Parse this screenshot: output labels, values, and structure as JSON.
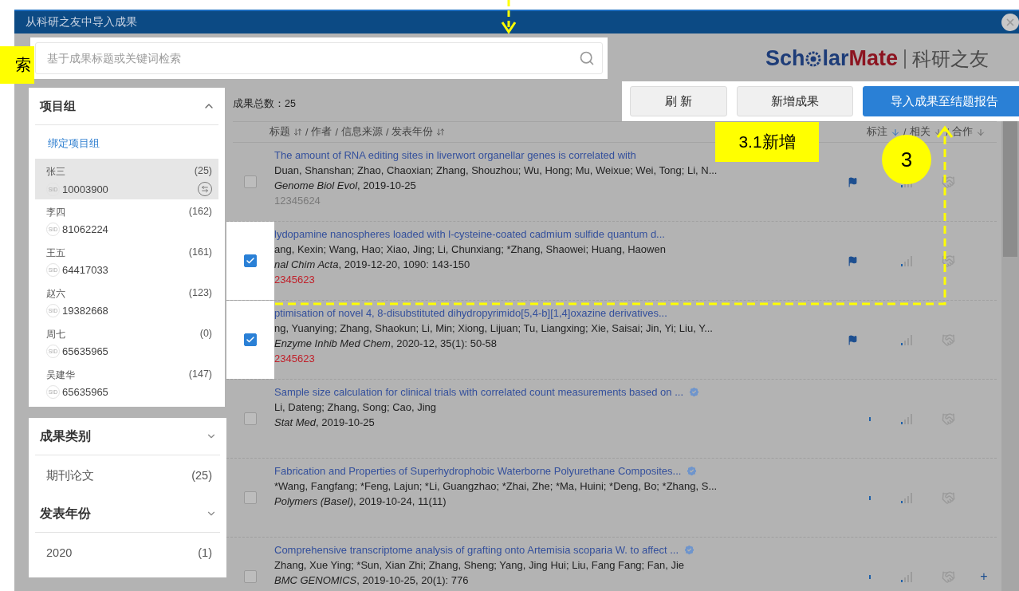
{
  "dialog": {
    "title": "从科研之友中导入成果"
  },
  "search": {
    "placeholder": "基于成果标题或关键词检索"
  },
  "logo": {
    "part_1": "Sch",
    "part_2": "lar",
    "part_3": "Mate",
    "tagline": "科研之友"
  },
  "sidebar": {
    "groups": {
      "title": "项目组",
      "expanded": true,
      "link": "绑定项目组",
      "members": [
        {
          "name": "张三",
          "count": "(25)",
          "sid_tag": "SID",
          "sid": "10003900",
          "selected": true
        },
        {
          "name": "李四",
          "count": "(162)",
          "sid_tag": "SID",
          "sid": "81062224",
          "selected": false
        },
        {
          "name": "王五",
          "count": "(161)",
          "sid_tag": "SID",
          "sid": "64417033",
          "selected": false
        },
        {
          "name": "赵六",
          "count": "(123)",
          "sid_tag": "SID",
          "sid": "19382668",
          "selected": false
        },
        {
          "name": "周七",
          "count": "(0)",
          "sid_tag": "SID",
          "sid": "65635965",
          "selected": false
        },
        {
          "name": "吴建华",
          "count": "(147)",
          "sid_tag": "SID",
          "sid": "65635965",
          "selected": false
        }
      ]
    },
    "filters": [
      {
        "title": "成果类别",
        "expanded": false,
        "items": [
          {
            "label": "期刊论文",
            "count": "(25)"
          }
        ]
      },
      {
        "title": "发表年份",
        "expanded": false,
        "items": [
          {
            "label": "2020",
            "count": "(1)"
          }
        ]
      }
    ]
  },
  "toolbar": {
    "total_label": "成果总数：",
    "total": "25",
    "buttons": [
      {
        "label": "刷 新",
        "kind": "plain"
      },
      {
        "label": "新增成果",
        "kind": "plain"
      },
      {
        "label": "导入成果至结题报告",
        "kind": "primary"
      }
    ]
  },
  "table": {
    "columns_left": [
      {
        "label": "标题",
        "kind": "sortable"
      },
      {
        "label": "作者",
        "divider": "/",
        "kind": "plain"
      },
      {
        "label": "信息来源",
        "divider": "/",
        "kind": "plain"
      },
      {
        "label": "发表年份",
        "divider": "/",
        "kind": "sortable"
      }
    ],
    "columns_right": [
      {
        "label": "标注",
        "sort_active": true
      },
      {
        "label": "相关",
        "divider": "/",
        "sort_active": false
      },
      {
        "label": "合作",
        "divider": "/",
        "sort_active": false
      }
    ],
    "rows": [
      {
        "checked": false,
        "title": "The amount of RNA editing sites in liverwort organellar genes is correlated with",
        "verified": false,
        "authors": "Duan, Shanshan; Zhao, Chaoxian; Zhang, Shouzhou; Wu, Hong; Mu, Weixue; Wei, Tong; Li, N...",
        "citation": "*Genome Biol Evol*, 2019-10-25",
        "code": "12345624",
        "code_highlighted": false,
        "flagged": true
      },
      {
        "checked": true,
        "title": "lydopamine nanospheres loaded with l-cysteine-coated cadmium sulfide quantum d...",
        "verified": false,
        "authors": "ang, Kexin; Wang, Hao; Xiao, Jing; Li, Chunxiang; *Zhang, Shaowei; Huang, Haowen",
        "citation": "*nal Chim Acta*, 2019-12-20, 1090: 143-150",
        "code": "2345623",
        "code_highlighted": true,
        "flagged": true
      },
      {
        "checked": true,
        "title": "ptimisation of novel 4, 8-disubstituted dihydropyrimido[5,4-b][1,4]oxazine derivatives...",
        "verified": false,
        "authors": "ng, Yuanying; Zhang, Shaokun; Li, Min; Xiong, Lijuan; Tu, Liangxing; Xie, Saisai; Jin, Yi; Liu, Y...",
        "citation": "*Enzyme Inhib Med Chem*, 2020-12, 35(1): 50-58",
        "code": "2345623",
        "code_highlighted": true,
        "flagged": true
      },
      {
        "checked": false,
        "title": "Sample size calculation for clinical trials with correlated count measurements based on ...",
        "verified": true,
        "authors": "Li, Dateng; Zhang, Song; Cao, Jing",
        "citation": "*Stat Med*, 2019-10-25",
        "flagged": false
      },
      {
        "checked": false,
        "title": "Fabrication and Properties of Superhydrophobic Waterborne Polyurethane Composites...",
        "verified": true,
        "authors": "*Wang, Fangfang; *Feng, Lajun; *Li, Guangzhao; *Zhai, Zhe; *Ma, Huini; *Deng, Bo; *Zhang, S...",
        "citation": "*Polymers (Basel)*, 2019-10-24, 11(11)",
        "flagged": false
      },
      {
        "checked": false,
        "title": "Comprehensive transcriptome analysis of grafting onto Artemisia scoparia W. to affect ...",
        "verified": true,
        "authors": "Zhang, Xue Ying; *Sun, Xian Zhi; Zhang, Sheng; Yang, Jing Hui; Liu, Fang Fang; Fan, Jie",
        "citation": "*BMC GENOMICS*, 2019-10-25, 20(1): 776",
        "flagged": false,
        "action": "+"
      }
    ]
  },
  "annotations": [
    {
      "kind": "edge-label",
      "text": "索"
    },
    {
      "kind": "tag",
      "text": "3.1新增"
    },
    {
      "kind": "step",
      "text": "3"
    }
  ]
}
